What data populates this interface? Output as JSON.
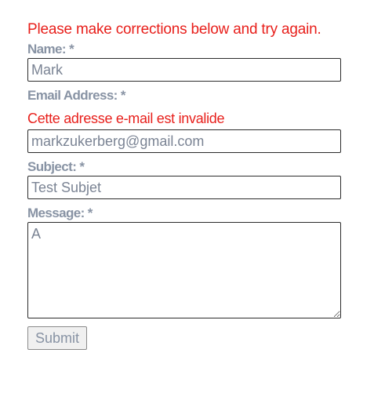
{
  "form": {
    "error_message": "Please make corrections below and try again.",
    "fields": {
      "name": {
        "label": "Name: *",
        "value": "Mark"
      },
      "email": {
        "label": "Email Address: *",
        "error": "Cette adresse e-mail est invalide",
        "value": "markzukerberg@gmail.com"
      },
      "subject": {
        "label": "Subject: *",
        "value": "Test Subjet"
      },
      "message": {
        "label": "Message: *",
        "value": "A"
      }
    },
    "submit_label": "Submit"
  },
  "colors": {
    "error": "#e8201c",
    "label": "#8893a4",
    "input_text": "#7b8494",
    "input_border": "#2b2b2b"
  }
}
